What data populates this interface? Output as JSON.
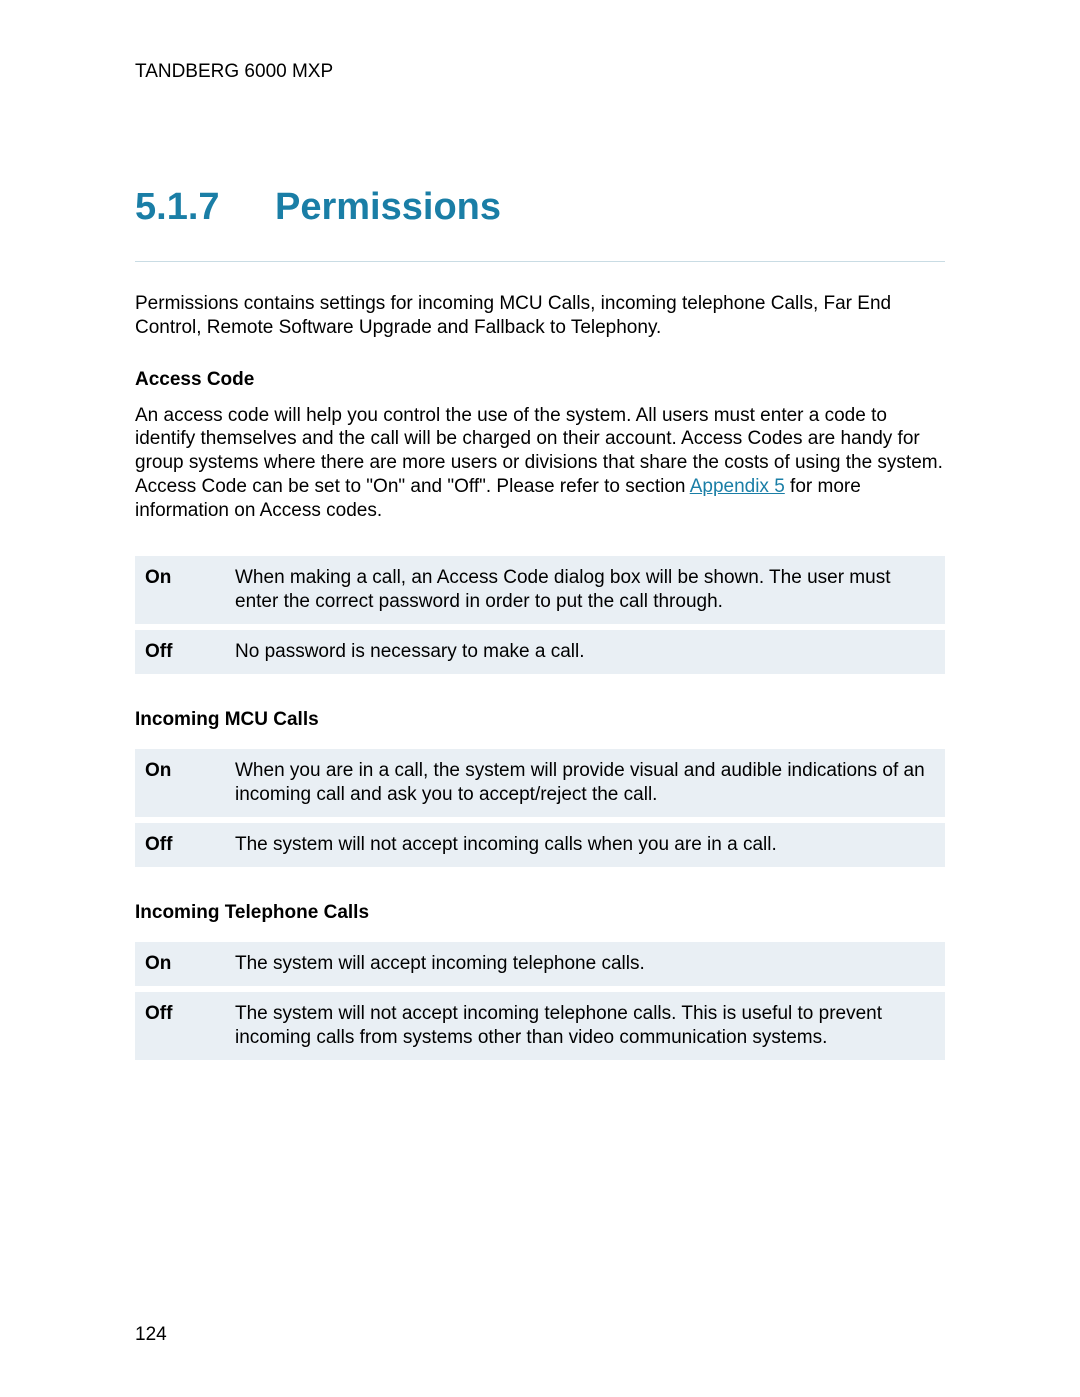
{
  "header": "TANDBERG 6000 MXP",
  "section_number": "5.1.7",
  "section_title": "Permissions",
  "intro": "Permissions contains settings for incoming MCU Calls, incoming telephone Calls, Far End Control, Remote Software Upgrade and Fallback to Telephony.",
  "access_code": {
    "heading": "Access Code",
    "body_pre": "An access code will help you control the use of the system. All users must enter a code to identify themselves and the call will be charged on their account. Access Codes are handy for group systems where there are more users or divisions that share the costs of using the system. Access Code can be set to \"On\" and \"Off\". Please refer to section ",
    "link_text": "Appendix 5",
    "body_post": " for more information on Access codes.",
    "rows": [
      {
        "opt": "On",
        "desc": "When making a call, an Access Code dialog box will be shown. The user must enter the correct password in order to put the call through."
      },
      {
        "opt": "Off",
        "desc": "No password is necessary to make a call."
      }
    ]
  },
  "mcu": {
    "heading": "Incoming MCU Calls",
    "rows": [
      {
        "opt": "On",
        "desc": "When you are in a call, the system will provide visual and audible indications of an incoming call and ask you to accept/reject the call."
      },
      {
        "opt": "Off",
        "desc": "The system will not accept incoming calls when you are in a call."
      }
    ]
  },
  "telephone": {
    "heading": "Incoming Telephone Calls",
    "rows": [
      {
        "opt": "On",
        "desc": "The system will accept incoming telephone calls."
      },
      {
        "opt": "Off",
        "desc": "The system will not accept incoming telephone calls. This is useful to prevent incoming calls from systems other than video communication systems."
      }
    ]
  },
  "page_number": "124"
}
